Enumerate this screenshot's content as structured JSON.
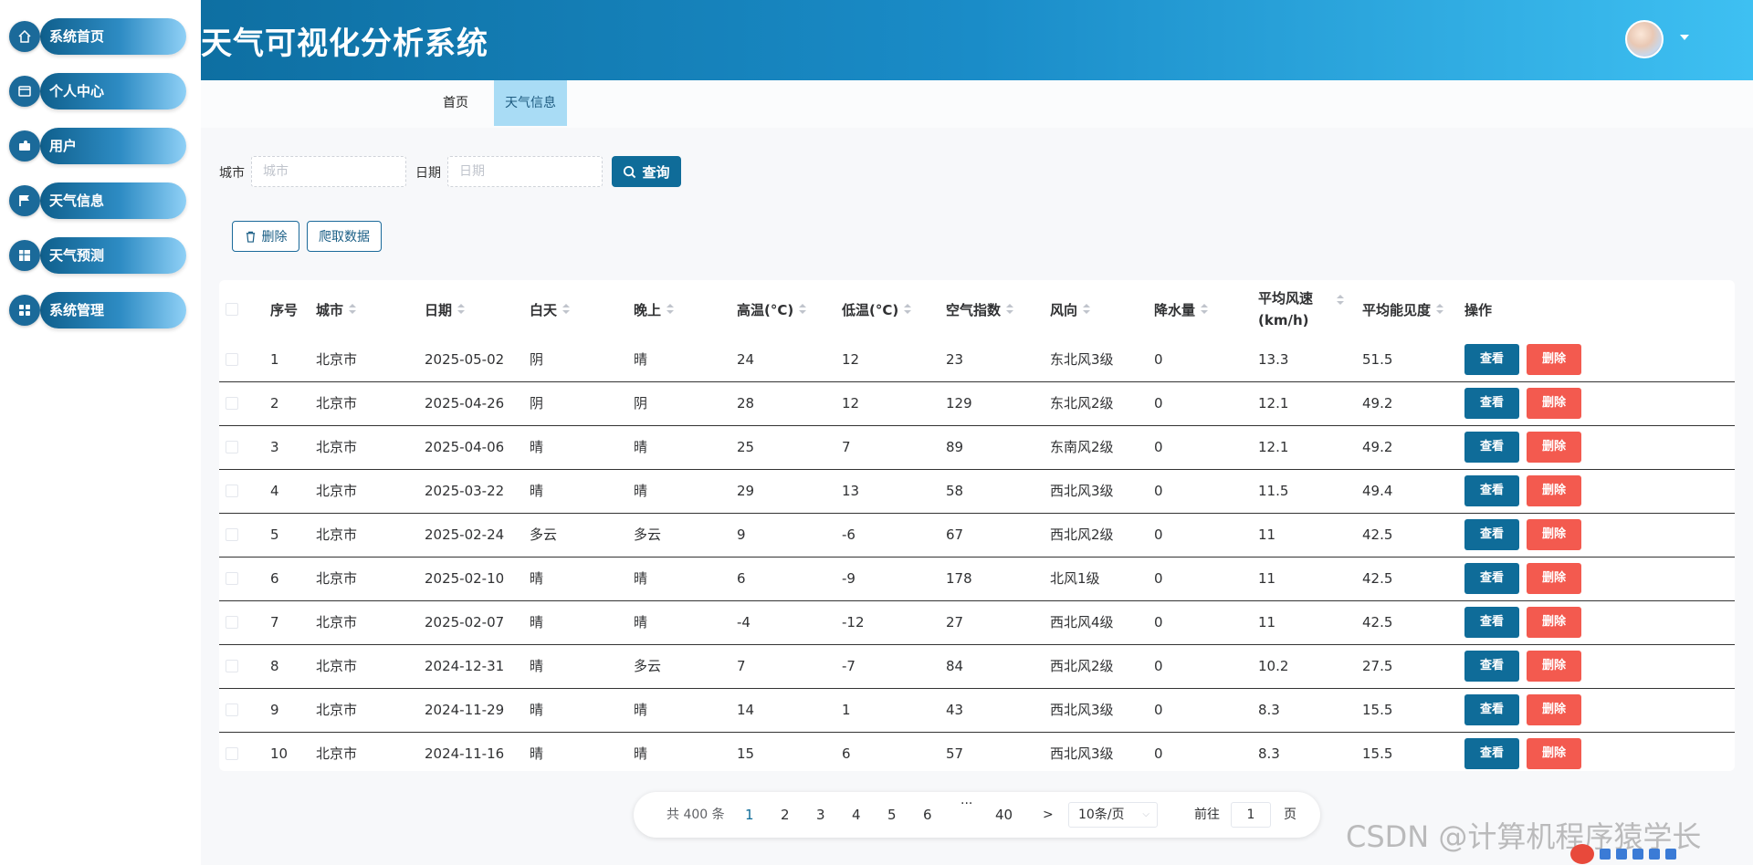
{
  "app": {
    "title": "天气可视化分析系统"
  },
  "sidebar": {
    "items": [
      {
        "label": "系统首页",
        "icon": "home-icon"
      },
      {
        "label": "个人中心",
        "icon": "profile-card-icon"
      },
      {
        "label": "用户",
        "icon": "user-icon"
      },
      {
        "label": "天气信息",
        "icon": "flag-icon"
      },
      {
        "label": "天气预测",
        "icon": "table-grid-icon"
      },
      {
        "label": "系统管理",
        "icon": "apps-grid-icon"
      }
    ]
  },
  "tabs": [
    {
      "label": "首页",
      "active": false
    },
    {
      "label": "天气信息",
      "active": true
    }
  ],
  "search": {
    "city_label": "城市",
    "city_placeholder": "城市",
    "date_label": "日期",
    "date_placeholder": "日期",
    "query_label": "查询"
  },
  "actions": {
    "delete_label": "删除",
    "crawl_label": "爬取数据"
  },
  "table": {
    "headers": [
      "序号",
      "城市",
      "日期",
      "白天",
      "晚上",
      "高温(°C)",
      "低温(°C)",
      "空气指数",
      "风向",
      "降水量",
      "平均风速(km/h)",
      "平均能见度",
      "操作"
    ],
    "view_label": "查看",
    "delete_label": "删除",
    "rows": [
      [
        "1",
        "北京市",
        "2025-05-02",
        "阴",
        "晴",
        "24",
        "12",
        "23",
        "东北风3级",
        "0",
        "13.3",
        "51.5"
      ],
      [
        "2",
        "北京市",
        "2025-04-26",
        "阴",
        "阴",
        "28",
        "12",
        "129",
        "东北风2级",
        "0",
        "12.1",
        "49.2"
      ],
      [
        "3",
        "北京市",
        "2025-04-06",
        "晴",
        "晴",
        "25",
        "7",
        "89",
        "东南风2级",
        "0",
        "12.1",
        "49.2"
      ],
      [
        "4",
        "北京市",
        "2025-03-22",
        "晴",
        "晴",
        "29",
        "13",
        "58",
        "西北风3级",
        "0",
        "11.5",
        "49.4"
      ],
      [
        "5",
        "北京市",
        "2025-02-24",
        "多云",
        "多云",
        "9",
        "-6",
        "67",
        "西北风2级",
        "0",
        "11",
        "42.5"
      ],
      [
        "6",
        "北京市",
        "2025-02-10",
        "晴",
        "晴",
        "6",
        "-9",
        "178",
        "北风1级",
        "0",
        "11",
        "42.5"
      ],
      [
        "7",
        "北京市",
        "2025-02-07",
        "晴",
        "晴",
        "-4",
        "-12",
        "27",
        "西北风4级",
        "0",
        "11",
        "42.5"
      ],
      [
        "8",
        "北京市",
        "2024-12-31",
        "晴",
        "多云",
        "7",
        "-7",
        "84",
        "西北风2级",
        "0",
        "10.2",
        "27.5"
      ],
      [
        "9",
        "北京市",
        "2024-11-29",
        "晴",
        "晴",
        "14",
        "1",
        "43",
        "西北风3级",
        "0",
        "8.3",
        "15.5"
      ],
      [
        "10",
        "北京市",
        "2024-11-16",
        "晴",
        "晴",
        "15",
        "6",
        "57",
        "西北风3级",
        "0",
        "8.3",
        "15.5"
      ]
    ]
  },
  "pagination": {
    "total_text": "共 400 条",
    "pages": [
      "1",
      "2",
      "3",
      "4",
      "5",
      "6"
    ],
    "ellipsis": "···",
    "last_page": "40",
    "next": ">",
    "page_size": "10条/页",
    "goto_label": "前往",
    "goto_value": "1",
    "page_suffix": "页",
    "current_page": 1
  },
  "watermark": "CSDN @计算机程序猿学长",
  "colors": {
    "primary": "#0f6c99",
    "danger": "#f35a4f",
    "header_start": "#0e6fa2",
    "header_end": "#3ec0f2",
    "tab_active": "#a9dcf5"
  }
}
